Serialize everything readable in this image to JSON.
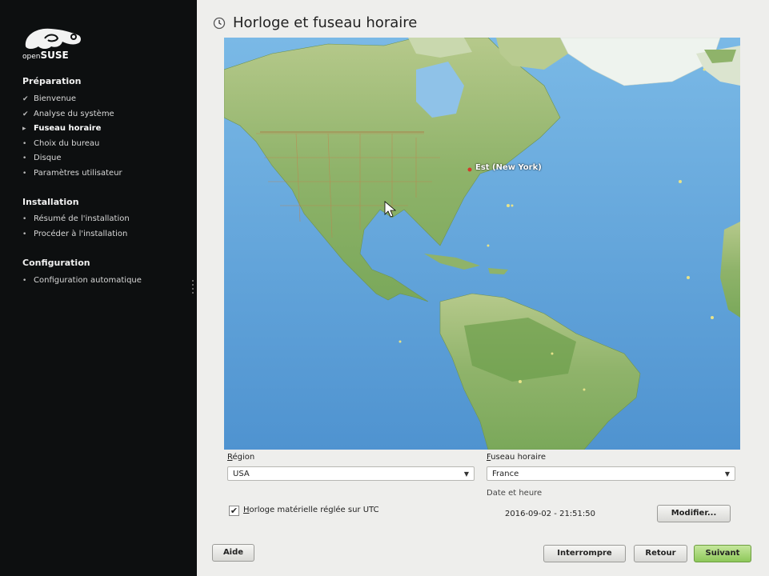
{
  "sidebar": {
    "logo_small": "open",
    "logo_big": "SUSE",
    "sections": [
      {
        "title": "Préparation",
        "steps": [
          {
            "label": "Bienvenue",
            "state": "done",
            "marker": "✔"
          },
          {
            "label": "Analyse du système",
            "state": "done",
            "marker": "✔"
          },
          {
            "label": "Fuseau horaire",
            "state": "active",
            "marker": "▸"
          },
          {
            "label": "Choix du bureau",
            "state": "todo",
            "marker": "•"
          },
          {
            "label": "Disque",
            "state": "todo",
            "marker": "•"
          },
          {
            "label": "Paramètres utilisateur",
            "state": "todo",
            "marker": "•"
          }
        ]
      },
      {
        "title": "Installation",
        "steps": [
          {
            "label": "Résumé de l'installation",
            "state": "todo",
            "marker": "•"
          },
          {
            "label": "Procéder à l'installation",
            "state": "todo",
            "marker": "•"
          }
        ]
      },
      {
        "title": "Configuration",
        "steps": [
          {
            "label": "Configuration automatique",
            "state": "todo",
            "marker": "•"
          }
        ]
      }
    ]
  },
  "main": {
    "title": "Horloge et fuseau horaire",
    "map_marker_label": "Est (New York)",
    "region_label_first": "R",
    "region_label_rest": "égion",
    "region_value": "USA",
    "tz_label_first": "F",
    "tz_label_rest": "useau horaire",
    "tz_value": "France",
    "date_time_label": "Date et heure",
    "date_time_value": "2016-09-02 - 21:51:50",
    "utc_label_first": "H",
    "utc_label_rest": "orloge matérielle réglée sur UTC",
    "utc_checked": true,
    "modify_button": "Modifier...",
    "help_button": "Aide",
    "abort_button": "Interrompre",
    "back_button": "Retour",
    "next_button": "Suivant"
  },
  "colors": {
    "sidebar_bg": "#0d0f10",
    "main_bg": "#eeeeec",
    "ocean": "#5fa2d8",
    "next_button": "#8ec85a"
  }
}
